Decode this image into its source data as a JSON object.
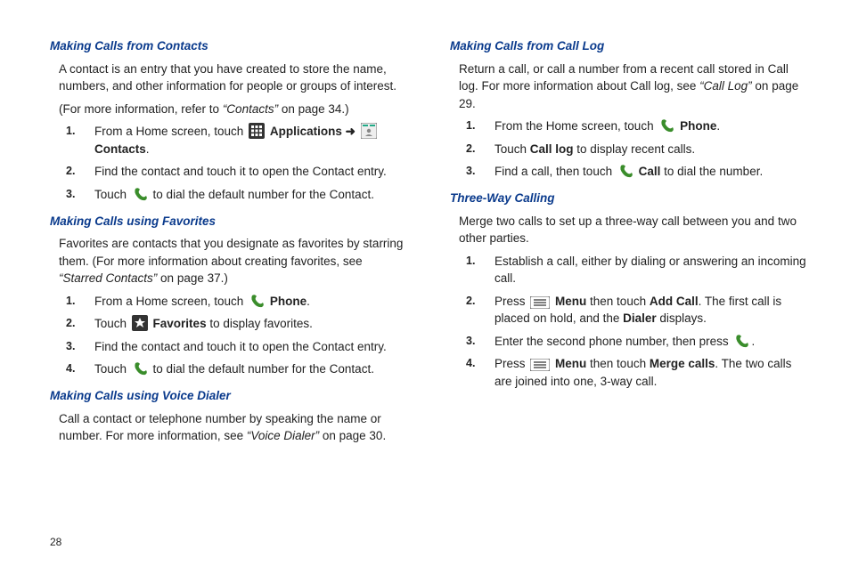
{
  "page_number": "28",
  "left": {
    "sec1": {
      "heading": "Making Calls from Contacts",
      "p1": "A contact is an entry that you have created to store the name, numbers, and other information for people or groups of interest.",
      "p2_a": "(For more information, refer to ",
      "p2_ref": "“Contacts”",
      "p2_b": " on page 34.)",
      "s1_a": "From a Home screen, touch ",
      "s1_apps": "Applications",
      "s1_arrow": " ➜ ",
      "s1_contacts": "Contacts",
      "s1_end": ".",
      "s2": "Find the contact and touch it to open the Contact entry.",
      "s3_a": "Touch ",
      "s3_b": " to dial the default number for the Contact."
    },
    "sec2": {
      "heading": "Making Calls using Favorites",
      "p1_a": "Favorites are contacts that you designate as favorites by starring them. (For more information about creating favorites, see ",
      "p1_ref": "“Starred Contacts”",
      "p1_b": " on page 37.)",
      "s1_a": "From a Home screen, touch ",
      "s1_phone": "Phone",
      "s1_end": ".",
      "s2_a": "Touch ",
      "s2_fav": "Favorites",
      "s2_b": " to display favorites.",
      "s3": "Find the contact and touch it to open the Contact entry.",
      "s4_a": "Touch ",
      "s4_b": " to dial the default number for the Contact."
    },
    "sec3": {
      "heading": "Making Calls using Voice Dialer",
      "p1_a": "Call a contact or telephone number by speaking the name or number. For more information, see ",
      "p1_ref": "“Voice Dialer”",
      "p1_b": " on page 30."
    }
  },
  "right": {
    "sec1": {
      "heading": "Making Calls from Call Log",
      "p1_a": "Return a call, or call a number from a recent call stored in Call log. For more information about Call log, see ",
      "p1_ref": "“Call Log”",
      "p1_b": " on page 29.",
      "s1_a": "From the Home screen, touch ",
      "s1_phone": "Phone",
      "s1_end": ".",
      "s2_a": "Touch ",
      "s2_calllog": "Call log",
      "s2_b": " to display recent calls.",
      "s3_a": "Find a call, then touch ",
      "s3_call": "Call",
      "s3_b": " to dial the number."
    },
    "sec2": {
      "heading": "Three-Way Calling",
      "p1": "Merge two calls to set up a three-way call between you and two other parties.",
      "s1": "Establish a call, either by dialing or answering an incoming call.",
      "s2_a": "Press ",
      "s2_menu": "Menu",
      "s2_b": " then touch ",
      "s2_addcall": "Add Call",
      "s2_c": ". The first call is placed on hold, and the ",
      "s2_dialer": "Dialer",
      "s2_d": " displays.",
      "s3_a": "Enter the second phone number, then press ",
      "s3_end": ".",
      "s4_a": "Press ",
      "s4_menu": "Menu",
      "s4_b": " then touch ",
      "s4_merge": "Merge calls",
      "s4_c": ". The two calls are joined into one, 3-way call."
    }
  }
}
